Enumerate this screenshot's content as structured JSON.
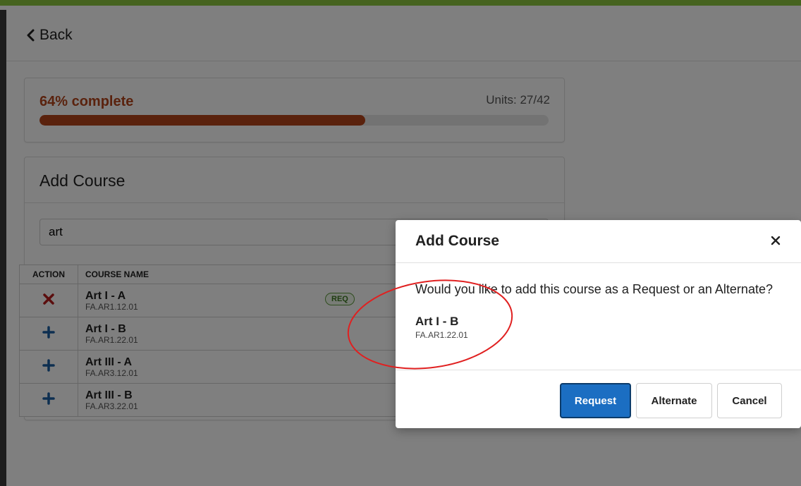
{
  "colors": {
    "accent_bar": "#8cc63f",
    "progress": "#b5441b",
    "remove": "#b71c1c",
    "add": "#1a5ea3",
    "primary_button": "#1b6ec2",
    "annotation": "#e02020"
  },
  "header": {
    "back_label": "Back"
  },
  "progress": {
    "percent_label": "64% complete",
    "units_label": "Units: 27/42",
    "fraction": 0.64
  },
  "add_course": {
    "title": "Add Course",
    "search_value": "art",
    "columns": {
      "action": "ACTION",
      "course_name": "COURSE NAME"
    },
    "rows": [
      {
        "name": "Art I - A",
        "code": "FA.AR1.12.01",
        "action": "remove",
        "badge": "REQ"
      },
      {
        "name": "Art I - B",
        "code": "FA.AR1.22.01",
        "action": "add"
      },
      {
        "name": "Art III - A",
        "code": "FA.AR3.12.01",
        "action": "add"
      },
      {
        "name": "Art III - B",
        "code": "FA.AR3.22.01",
        "action": "add"
      }
    ]
  },
  "modal": {
    "title": "Add Course",
    "question": "Would you like to add this course as a Request or an Alternate?",
    "course_name": "Art I - B",
    "course_code": "FA.AR1.22.01",
    "buttons": {
      "request": "Request",
      "alternate": "Alternate",
      "cancel": "Cancel"
    }
  }
}
